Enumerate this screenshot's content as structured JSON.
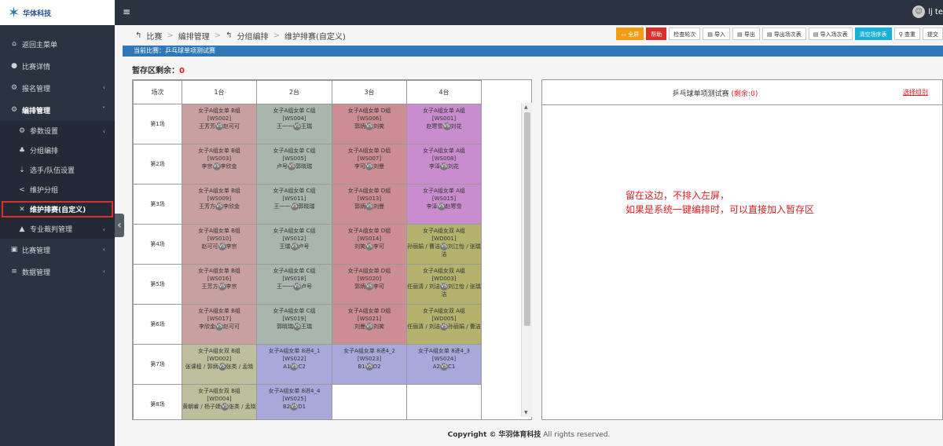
{
  "logo": {
    "text": "华体科技"
  },
  "sidebar": {
    "items": [
      {
        "label": "返回主菜单",
        "icon": "home-icon",
        "glyph": "⌂"
      },
      {
        "label": "比赛详情",
        "icon": "info-icon",
        "glyph": "●"
      },
      {
        "label": "报名管理",
        "icon": "gears-icon",
        "glyph": "⚙",
        "arrow": "‹"
      },
      {
        "label": "编排管理",
        "icon": "gear-icon",
        "glyph": "⚙",
        "arrow": "˅"
      },
      {
        "label": "参数设置",
        "icon": "gear-icon",
        "glyph": "⚙",
        "arrow": "‹"
      },
      {
        "label": "分组编排",
        "icon": "sitemap-icon",
        "glyph": "♣"
      },
      {
        "label": "选手/队伍设置",
        "icon": "download-icon",
        "glyph": "⇣"
      },
      {
        "label": "维护分组",
        "icon": "share-icon",
        "glyph": "<"
      },
      {
        "label": "维护排赛(自定义)",
        "icon": "random-icon",
        "glyph": "✕"
      },
      {
        "label": "专业裁判管理",
        "icon": "graduation-icon",
        "glyph": "▲",
        "arrow": "‹"
      },
      {
        "label": "比赛管理",
        "icon": "table-icon",
        "glyph": "▣",
        "arrow": "‹"
      },
      {
        "label": "数据管理",
        "icon": "database-icon",
        "glyph": "≡",
        "arrow": "‹"
      }
    ]
  },
  "topbar": {
    "user": "lj te"
  },
  "breadcrumb": [
    "比赛",
    "编排管理",
    "分组编排",
    "维护排赛(自定义)"
  ],
  "toolbar": [
    "全屏",
    "帮助",
    "检查轮次",
    "导入",
    "导出",
    "导出场次表",
    "导入场次表",
    "清空场序表",
    "查重",
    "提交"
  ],
  "match_bar": "当前比赛：乒乓球单项测试赛",
  "holding": {
    "label": "暂存区剩余：",
    "count": "0"
  },
  "schedule": {
    "headers": [
      "场次",
      "1台",
      "2台",
      "3台",
      "4台"
    ],
    "rows": [
      {
        "label": "第1场",
        "cells": [
          {
            "c": "b",
            "g": "女子A组女单 B组",
            "id": "[WS002]",
            "p1": "王芳芳",
            "p2": "赵可可"
          },
          {
            "c": "c",
            "g": "女子A组女单 C组",
            "id": "[WS004]",
            "p1": "王一一",
            "p2": "王瑞"
          },
          {
            "c": "d",
            "g": "女子A组女单 D组",
            "id": "[WS006]",
            "p1": "郭炳",
            "p2": "刘笑"
          },
          {
            "c": "a",
            "g": "女子A组女单 A组",
            "id": "[WS001]",
            "p1": "赵寒雪",
            "p2": "刘花"
          }
        ]
      },
      {
        "label": "第2场",
        "cells": [
          {
            "c": "b",
            "g": "女子A组女单 B组",
            "id": "[WS003]",
            "p1": "李宗",
            "p2": "李欣金"
          },
          {
            "c": "c",
            "g": "女子A组女单 C组",
            "id": "[WS005]",
            "p1": "卢号",
            "p2": "郭晓瑞"
          },
          {
            "c": "d",
            "g": "女子A组女单 D组",
            "id": "[WS007]",
            "p1": "李可",
            "p2": "刘曼"
          },
          {
            "c": "a",
            "g": "女子A组女单 A组",
            "id": "[WS008]",
            "p1": "李泽",
            "p2": "刘花"
          }
        ]
      },
      {
        "label": "第3场",
        "cells": [
          {
            "c": "b",
            "g": "女子A组女单 B组",
            "id": "[WS009]",
            "p1": "王芳方",
            "p2": "李欣金"
          },
          {
            "c": "c",
            "g": "女子A组女单 C组",
            "id": "[WS011]",
            "p1": "王一一",
            "p2": "郭晓瑞"
          },
          {
            "c": "d",
            "g": "女子A组女单 D组",
            "id": "[WS013]",
            "p1": "郭炳",
            "p2": "刘曼"
          },
          {
            "c": "a",
            "g": "女子A组女单 A组",
            "id": "[WS015]",
            "p1": "李泽",
            "p2": "赵寒雪"
          }
        ]
      },
      {
        "label": "第4场",
        "cells": [
          {
            "c": "b",
            "g": "女子A组女单 B组",
            "id": "[WS010]",
            "p1": "赵可可",
            "p2": "李宗"
          },
          {
            "c": "c",
            "g": "女子A组女单 C组",
            "id": "[WS012]",
            "p1": "王瑞",
            "p2": "卢号"
          },
          {
            "c": "d",
            "g": "女子A组女单 D组",
            "id": "[WS014]",
            "p1": "刘笑",
            "p2": "李可"
          },
          {
            "c": "wa",
            "g": "女子A组女双 A组",
            "id": "[WD001]",
            "p1": "孙丽娟 / 曹洁",
            "p2": "刘江怡 / 张瑞洁"
          }
        ]
      },
      {
        "label": "第5场",
        "cells": [
          {
            "c": "b",
            "g": "女子A组女单 B组",
            "id": "[WS016]",
            "p1": "王芳方",
            "p2": "李宗"
          },
          {
            "c": "c",
            "g": "女子A组女单 C组",
            "id": "[WS018]",
            "p1": "王一一",
            "p2": "卢号"
          },
          {
            "c": "d",
            "g": "女子A组女单 D组",
            "id": "[WS020]",
            "p1": "郭炳",
            "p2": "李可"
          },
          {
            "c": "wa",
            "g": "女子A组女双 A组",
            "id": "[WD003]",
            "p1": "任丽清 / 刘洁",
            "p2": "刘江怡 / 张瑞洁"
          }
        ]
      },
      {
        "label": "第6场",
        "cells": [
          {
            "c": "b",
            "g": "女子A组女单 B组",
            "id": "[WS017]",
            "p1": "李欣金",
            "p2": "赵可可"
          },
          {
            "c": "c",
            "g": "女子A组女单 C组",
            "id": "[WS019]",
            "p1": "郭晓瑞",
            "p2": "王瑞"
          },
          {
            "c": "d",
            "g": "女子A组女单 D组",
            "id": "[WS021]",
            "p1": "刘曼",
            "p2": "刘笑"
          },
          {
            "c": "wa",
            "g": "女子A组女双 A组",
            "id": "[WD005]",
            "p1": "任丽清 / 刘洁",
            "p2": "孙丽娟 / 曹洁"
          }
        ]
      },
      {
        "label": "第7场",
        "cells": [
          {
            "c": "wb",
            "g": "女子A组女双 B组",
            "id": "[WD002]",
            "p1": "张课程 / 郭炳",
            "p2": "张类 / 孟晓"
          },
          {
            "c": "k",
            "g": "女子A组女单 8进4_1",
            "id": "[WS022]",
            "p1": "A1",
            "p2": "C2"
          },
          {
            "c": "k",
            "g": "女子A组女单 8进4_2",
            "id": "[WS023]",
            "p1": "B1",
            "p2": "D2"
          },
          {
            "c": "k",
            "g": "女子A组女单 8进4_3",
            "id": "[WS024]",
            "p1": "A2",
            "p2": "C1"
          }
        ]
      },
      {
        "label": "第8场",
        "cells": [
          {
            "c": "wb",
            "g": "女子A组女双 B组",
            "id": "[WD004]",
            "p1": "黄朝睿 / 杨子婕",
            "p2": "张类 / 孟晓"
          },
          {
            "c": "k",
            "g": "女子A组女单 8进4_4",
            "id": "[WS025]",
            "p1": "B2",
            "p2": "D1"
          },
          {
            "c": "e"
          },
          {
            "c": "e"
          }
        ]
      }
    ]
  },
  "right_panel": {
    "title": "乒乓球单项测试赛",
    "remain": "(剩余:0)",
    "link": "选择组别",
    "note_line1": "留在这边，不排入左屏，",
    "note_line2": "如果是系统一键编排时，可以直接加入暂存区"
  },
  "footer": {
    "copyright": "Copyright ©",
    "company": "华羽体育科技",
    "rights": "All rights reserved."
  }
}
